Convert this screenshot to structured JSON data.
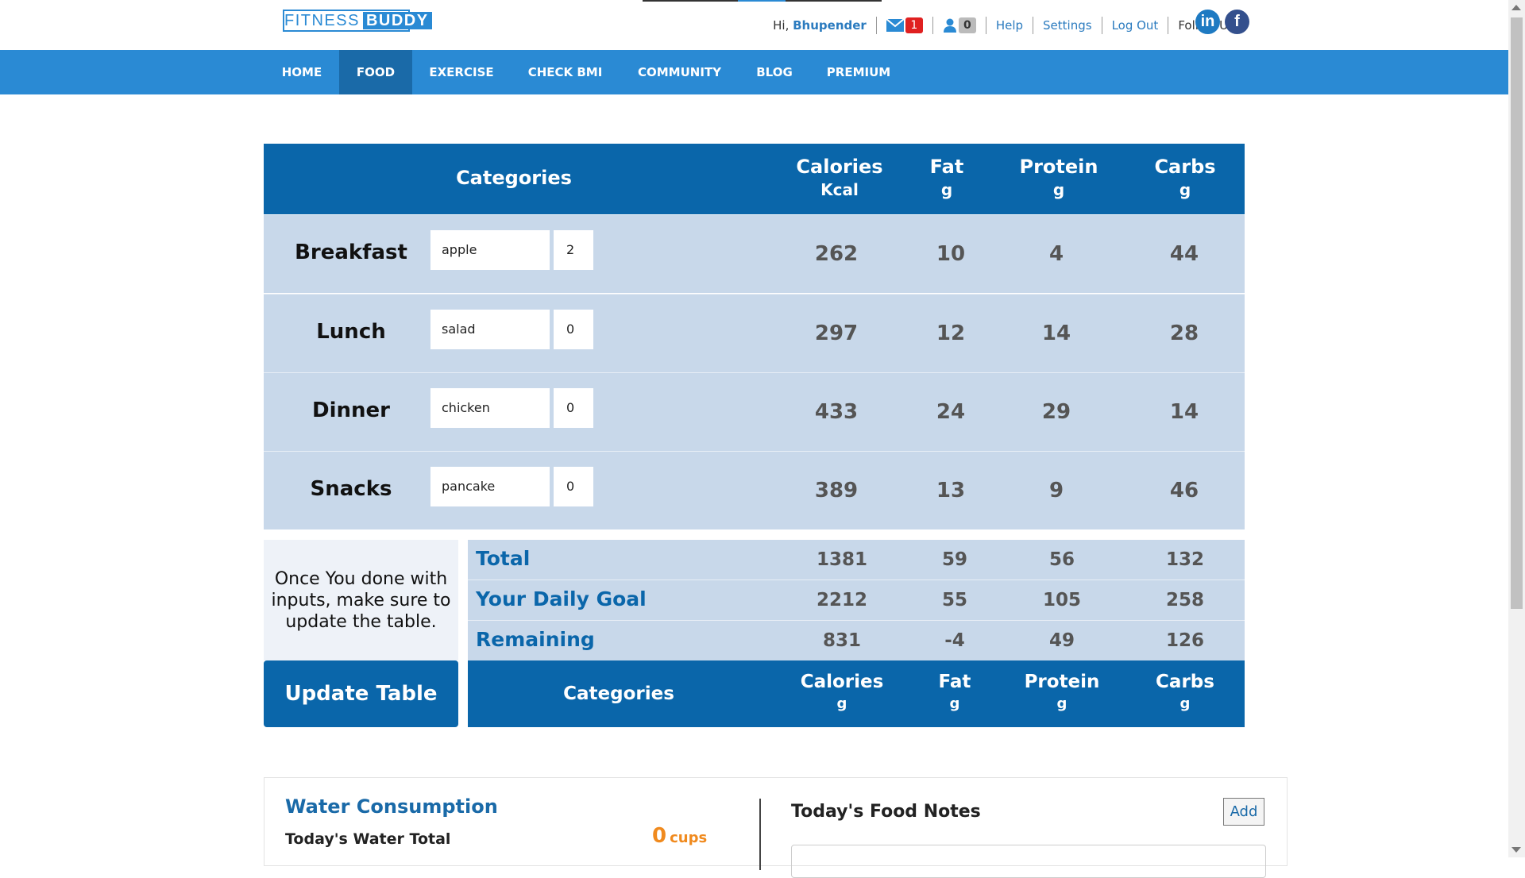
{
  "header": {
    "logo_part1": "FITNESS",
    "logo_part2": "BUDDY",
    "greeting_prefix": "Hi,",
    "username": "Bhupender",
    "messages_count": "1",
    "friends_count": "0",
    "help": "Help",
    "settings": "Settings",
    "logout": "Log Out",
    "follow_us": "Follow Us:",
    "linkedin": "in",
    "facebook": "f"
  },
  "nav": {
    "items": [
      "HOME",
      "FOOD",
      "EXERCISE",
      "CHECK BMI",
      "COMMUNITY",
      "BLOG",
      "PREMIUM"
    ],
    "active": "FOOD"
  },
  "food_table": {
    "headers": {
      "categories": "Categories",
      "calories": "Calories",
      "calories_unit": "Kcal",
      "fat": "Fat",
      "fat_unit": "g",
      "protein": "Protein",
      "protein_unit": "g",
      "carbs": "Carbs",
      "carbs_unit": "g"
    },
    "rows": [
      {
        "category": "Breakfast",
        "food": "apple",
        "qty": "2",
        "calories": "262",
        "fat": "10",
        "protein": "4",
        "carbs": "44"
      },
      {
        "category": "Lunch",
        "food": "salad",
        "qty": "0",
        "calories": "297",
        "fat": "12",
        "protein": "14",
        "carbs": "28"
      },
      {
        "category": "Dinner",
        "food": "chicken",
        "qty": "0",
        "calories": "433",
        "fat": "24",
        "protein": "29",
        "carbs": "14"
      },
      {
        "category": "Snacks",
        "food": "pancake",
        "qty": "0",
        "calories": "389",
        "fat": "13",
        "protein": "9",
        "carbs": "46"
      }
    ]
  },
  "summary": {
    "note": "Once You done with inputs, make sure to update the table.",
    "update_button": "Update Table",
    "rows": [
      {
        "label": "Total",
        "calories": "1381",
        "fat": "59",
        "protein": "56",
        "carbs": "132"
      },
      {
        "label": "Your Daily Goal",
        "calories": "2212",
        "fat": "55",
        "protein": "105",
        "carbs": "258"
      },
      {
        "label": "Remaining",
        "calories": "831",
        "fat": "-4",
        "protein": "49",
        "carbs": "126"
      }
    ],
    "footer": {
      "categories": "Categories",
      "calories": "Calories",
      "calories_unit": "g",
      "fat": "Fat",
      "fat_unit": "g",
      "protein": "Protein",
      "protein_unit": "g",
      "carbs": "Carbs",
      "carbs_unit": "g"
    }
  },
  "water": {
    "title": "Water Consumption",
    "total_label": "Today's Water Total",
    "value": "0",
    "unit": "cups"
  },
  "food_notes": {
    "title": "Today's Food Notes",
    "add_button": "Add"
  },
  "colors": {
    "nav_bg": "#2a8ad4",
    "nav_active": "#1a6aa8",
    "table_header": "#0a66aa",
    "row_bg": "#c8d8ea",
    "accent_orange": "#f08a1e"
  }
}
